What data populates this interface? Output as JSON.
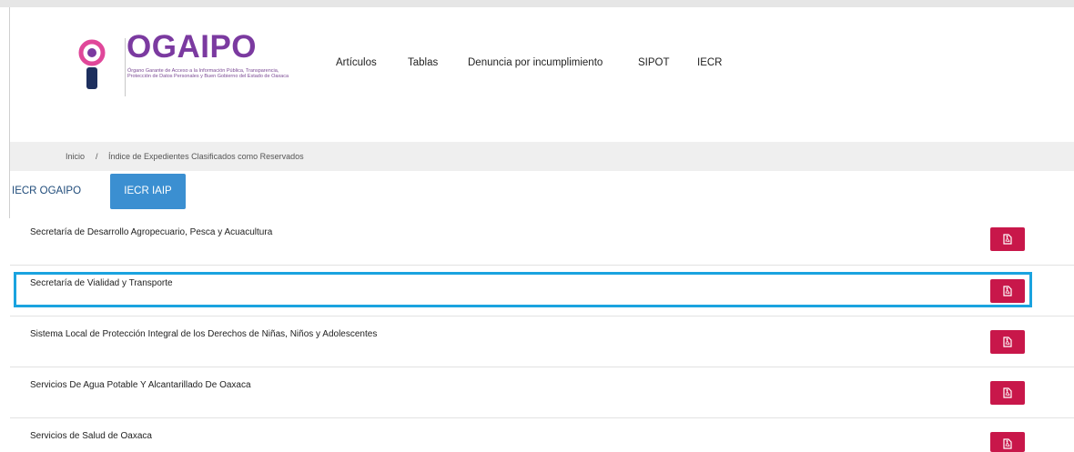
{
  "brand": {
    "title": "OGAIPO",
    "subtitle": "Órgano Garante de Acceso a la Información Pública, Transparencia, Protección de Datos Personales y Buen Gobierno del Estado de Oaxaca"
  },
  "nav": {
    "items": [
      "Artículos",
      "Tablas",
      "Denuncia por incumplimiento",
      "SIPOT",
      "IECR"
    ]
  },
  "breadcrumb": {
    "home": "Inicio",
    "separator": "/",
    "current": "Índice de Expedientes Clasificados como Reservados"
  },
  "tabs": {
    "items": [
      "IECR OGAIPO",
      "IECR IAIP"
    ],
    "active": "IECR IAIP"
  },
  "list": {
    "items": [
      "Secretaría de Desarrollo Agropecuario, Pesca y Acuacultura",
      "Secretaría de Vialidad y Transporte",
      "Sistema Local de Protección Integral de los Derechos de Niñas, Niños y Adolescentes",
      "Servicios De Agua Potable Y Alcantarillado De Oaxaca",
      "Servicios de Salud de Oaxaca"
    ],
    "highlighted": "Secretaría de Vialidad y Transporte"
  },
  "icons": {
    "logo": "ogaipo-logo-icon",
    "pdf": "pdf-file-icon"
  },
  "colors": {
    "brand_purple": "#7b3aa0",
    "brand_navy": "#1d2f5e",
    "tab_active": "#3b8fd1",
    "pdf_button": "#c8174a",
    "highlight": "#1aa3df"
  }
}
